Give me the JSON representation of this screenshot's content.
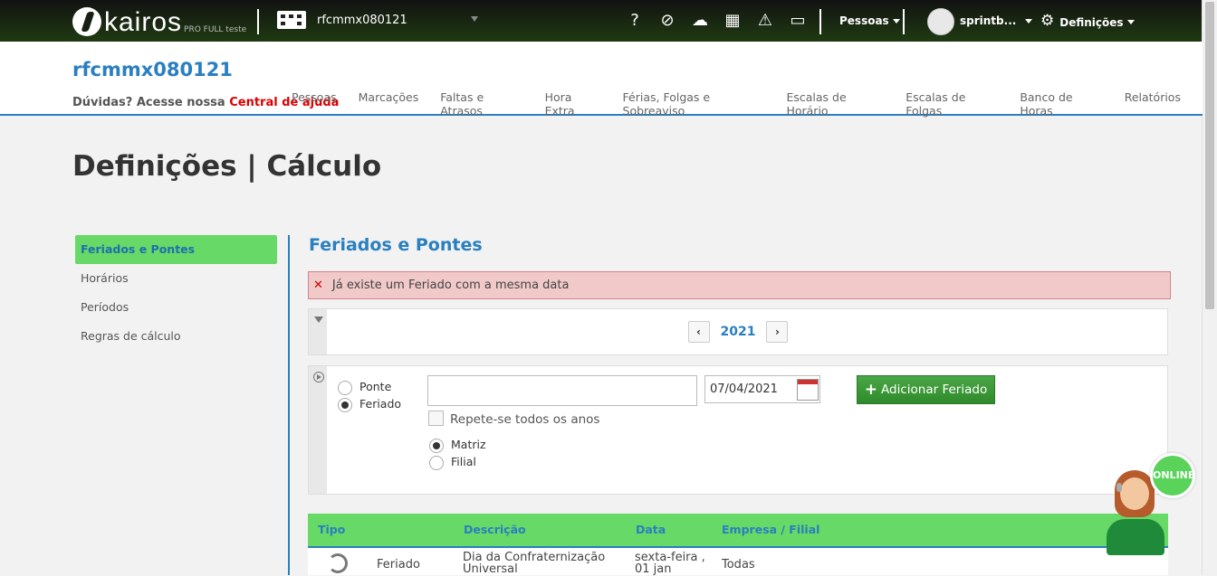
{
  "topbar": {
    "logo_text": "kairos",
    "logo_sub": "PRO FULL teste",
    "company": "rfcmmx080121",
    "icons": [
      "question-icon",
      "hand-coin-icon",
      "cloud-download-icon",
      "calculator-icon",
      "warning-icon",
      "inbox-icon"
    ],
    "pessoas": "Pessoas",
    "user": "sprintb...",
    "settings": "Definições"
  },
  "header": {
    "title": "rfcmmx080121",
    "help_prefix": "Dúvidas? Acesse nossa",
    "help_link": "Central de ajuda",
    "nav": [
      "Pessoas",
      "Marcações",
      "Faltas e Atrasos",
      "Hora Extra",
      "Férias, Folgas e Sobreaviso",
      "Escalas de Horário",
      "Escalas de Folgas",
      "Banco de Horas",
      "Relatórios"
    ]
  },
  "page_title": "Definições | Cálculo",
  "sidebar": {
    "items": [
      {
        "label": "Feriados e Pontes",
        "active": true
      },
      {
        "label": "Horários"
      },
      {
        "label": "Períodos"
      },
      {
        "label": "Regras de cálculo"
      }
    ]
  },
  "section": {
    "title": "Feriados e Pontes",
    "alert": "Já existe um Feriado com a mesma data",
    "year": "2021",
    "prev": "‹",
    "next": "›"
  },
  "form": {
    "type_options": [
      "Ponte",
      "Feriado"
    ],
    "type_selected": "Feriado",
    "description_value": "",
    "date_value": "07/04/2021",
    "repeat_label": "Repete-se todos os anos",
    "scope_options": [
      "Matriz",
      "Filial"
    ],
    "scope_selected": "Matriz",
    "add_button": "Adicionar Feriado"
  },
  "table": {
    "headers": [
      "Tipo",
      "Descrição",
      "Data",
      "Empresa / Filial"
    ],
    "rows": [
      {
        "tipo": "Feriado",
        "descricao_1": "Dia da Confraternização",
        "descricao_2": "Universal",
        "data_1": "sexta-feira ,",
        "data_2": "01 jan",
        "empresa": "Todas"
      }
    ]
  },
  "chat": {
    "status": "ONLINE"
  },
  "colors": {
    "accent": "#2a7fc0",
    "active_green": "#66d966",
    "alert_bg": "#f1c9c9",
    "help_red": "#dd0000"
  }
}
